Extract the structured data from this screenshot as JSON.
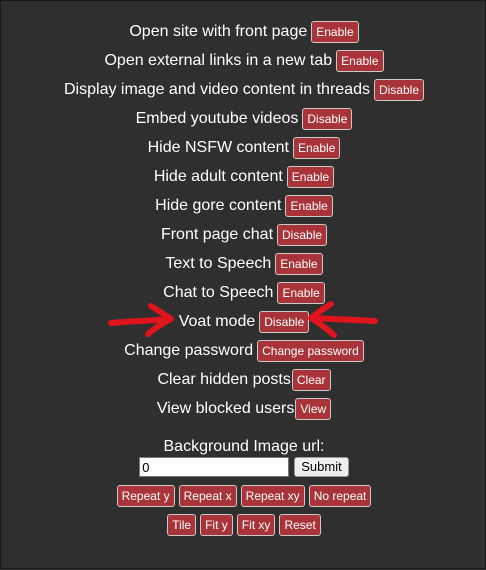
{
  "settings": [
    {
      "label": "Open site with front page",
      "button": "Enable"
    },
    {
      "label": "Open external links in a new tab",
      "button": "Enable"
    },
    {
      "label": "Display image and video content in threads",
      "button": "Disable"
    },
    {
      "label": "Embed youtube videos",
      "button": "Disable"
    },
    {
      "label": "Hide NSFW content",
      "button": "Enable"
    },
    {
      "label": "Hide adult content",
      "button": "Enable"
    },
    {
      "label": "Hide gore content",
      "button": "Enable"
    },
    {
      "label": "Front page chat",
      "button": "Disable"
    },
    {
      "label": "Text to Speech",
      "button": "Enable"
    },
    {
      "label": "Chat to Speech",
      "button": "Enable"
    },
    {
      "label": "Voat mode",
      "button": "Disable"
    },
    {
      "label": "Change password",
      "button": "Change password"
    },
    {
      "label": "Clear hidden posts",
      "button": "Clear"
    },
    {
      "label": "View blocked users",
      "button": "View"
    }
  ],
  "background": {
    "label": "Background Image url:",
    "input_value": "0",
    "submit_label": "Submit",
    "repeat_buttons": [
      "Repeat y",
      "Repeat x",
      "Repeat xy",
      "No repeat"
    ],
    "fit_buttons": [
      "Tile",
      "Fit y",
      "Fit xy",
      "Reset"
    ]
  },
  "colors": {
    "background": "#2f2f2f",
    "button": "#a8343a",
    "annotation_arrow": "#e0141c"
  },
  "annotation": {
    "type": "red-hand-drawn-arrows",
    "points_to": "Voat mode"
  }
}
